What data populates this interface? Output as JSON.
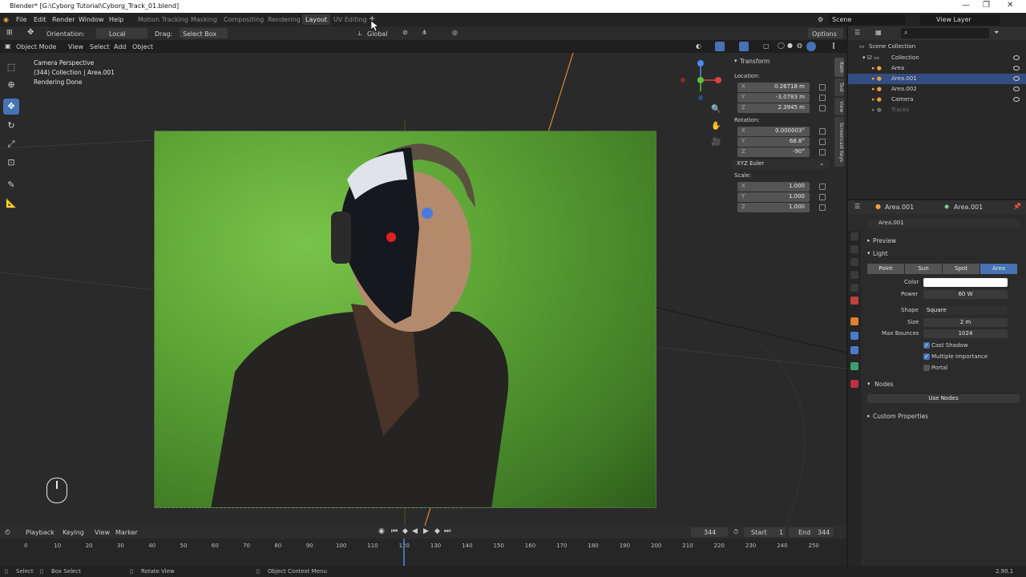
{
  "window": {
    "title": "Blender* [G:\\Cyborg Tutorial\\Cyborg_Track_01.blend]"
  },
  "menus": [
    "File",
    "Edit",
    "Render",
    "Window",
    "Help"
  ],
  "workspaces": [
    "Motion Tracking",
    "Masking",
    "Compositing",
    "Rendering",
    "Layout",
    "UV Editing"
  ],
  "active_workspace": "Layout",
  "topright": {
    "scene": "Scene",
    "view_layer": "View Layer"
  },
  "tool_header": {
    "orientation_label": "Orientation:",
    "orientation_value": "Local",
    "drag_label": "Drag:",
    "drag_value": "Select Box",
    "pivot_value": "Global",
    "options": "Options"
  },
  "view_header": {
    "mode": "Object Mode",
    "menus": [
      "View",
      "Select",
      "Add",
      "Object"
    ]
  },
  "viewport_info": {
    "line1": "Camera Perspective",
    "line2": "(344) Collection | Area.001",
    "line3": "Rendering Done"
  },
  "npanel": {
    "title": "Transform",
    "location_label": "Location:",
    "location": [
      {
        "axis": "X",
        "value": "0.26718 m"
      },
      {
        "axis": "Y",
        "value": "-3.0783 m"
      },
      {
        "axis": "Z",
        "value": "2.3945 m"
      }
    ],
    "rotation_label": "Rotation:",
    "rotation": [
      {
        "axis": "X",
        "value": "0.000003°"
      },
      {
        "axis": "Y",
        "value": "68.8°"
      },
      {
        "axis": "Z",
        "value": "-90°"
      }
    ],
    "rotation_mode": "XYZ Euler",
    "scale_label": "Scale:",
    "scale": [
      {
        "axis": "X",
        "value": "1.000"
      },
      {
        "axis": "Y",
        "value": "1.000"
      },
      {
        "axis": "Z",
        "value": "1.000"
      }
    ],
    "tabs": [
      "Item",
      "Tool",
      "View",
      "Screencast Keys"
    ]
  },
  "outliner": {
    "title": "Scene Collection",
    "rows": [
      {
        "name": "Collection",
        "selected": false
      },
      {
        "name": "Area",
        "selected": false
      },
      {
        "name": "Area.001",
        "selected": true
      },
      {
        "name": "Area.002",
        "selected": false
      },
      {
        "name": "Camera",
        "selected": false
      },
      {
        "name": "Tracks",
        "selected": false
      }
    ]
  },
  "properties": {
    "breadcrumb1": "Area.001",
    "breadcrumb2": "Area.001",
    "data_name": "Area.001",
    "preview": "Preview",
    "light": "Light",
    "light_types": [
      "Point",
      "Sun",
      "Spot",
      "Area"
    ],
    "active_light_type": "Area",
    "color_label": "Color",
    "power_label": "Power",
    "power_value": "60 W",
    "shape_label": "Shape",
    "shape_value": "Square",
    "size_label": "Size",
    "size_value": "2 m",
    "max_bounces_label": "Max Bounces",
    "max_bounces_value": "1024",
    "cast_shadow": "Cast Shadow",
    "multiple_importance": "Multiple Importance",
    "portal": "Portal",
    "nodes": "Nodes",
    "use_nodes": "Use Nodes",
    "custom_properties": "Custom Properties"
  },
  "timeline": {
    "menus": [
      "Playback",
      "Keying",
      "View",
      "Marker"
    ],
    "current_frame": "344",
    "start_label": "Start",
    "start": "1",
    "end_label": "End",
    "end": "344",
    "ticks": [
      "0",
      "10",
      "20",
      "30",
      "40",
      "50",
      "60",
      "70",
      "80",
      "90",
      "100",
      "110",
      "120",
      "130",
      "140",
      "150",
      "160",
      "170",
      "180",
      "190",
      "200",
      "210",
      "220",
      "230",
      "240",
      "250"
    ]
  },
  "statusbar": {
    "select": "Select",
    "box_select": "Box Select",
    "rotate_view": "Rotate View",
    "context_menu": "Object Context Menu",
    "version": "2.90.1"
  },
  "colors": {
    "accent": "#4772b3",
    "green_screen": "#5aa234"
  }
}
